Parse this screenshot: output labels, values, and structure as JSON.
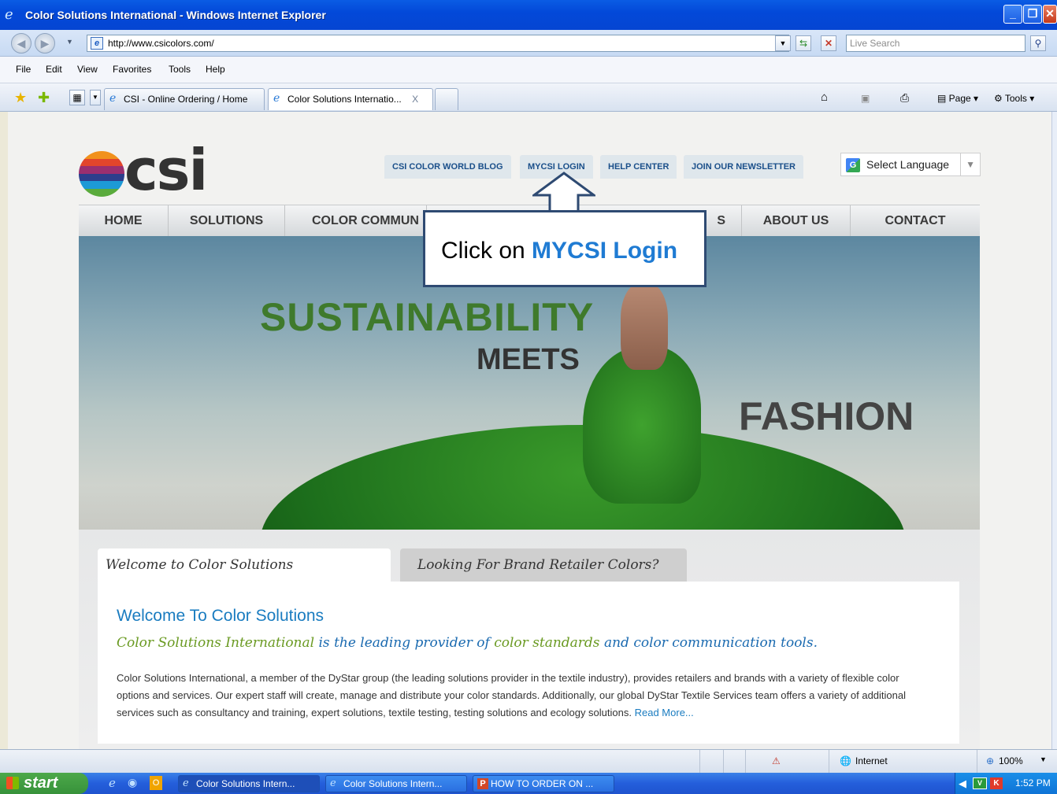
{
  "window": {
    "title": "Color Solutions International - Windows Internet Explorer"
  },
  "address": {
    "url": "http://www.csicolors.com/",
    "search_placeholder": "Live Search"
  },
  "menu": [
    "File",
    "Edit",
    "View",
    "Favorites",
    "Tools",
    "Help"
  ],
  "tabs": [
    {
      "label": "CSI - Online Ordering / Home"
    },
    {
      "label": "Color Solutions Internatio...",
      "close": "X"
    }
  ],
  "command_bar": {
    "page": "Page",
    "tools": "Tools"
  },
  "site": {
    "logo_text": "csi",
    "top_links": [
      "CSI COLOR WORLD BLOG",
      "MYCSI LOGIN",
      "HELP CENTER",
      "JOIN OUR NEWSLETTER"
    ],
    "language": "Select Language",
    "nav": [
      "HOME",
      "SOLUTIONS",
      "COLOR COMMUN",
      "S",
      "ABOUT US",
      "CONTACT"
    ],
    "hero": {
      "line1": "SUSTAINABILITY",
      "line2": "MEETS",
      "line3": "FASHION"
    },
    "content_tabs": [
      "Welcome to Color Solutions International",
      "Looking For Brand Retailer Colors?"
    ],
    "welcome_heading": "Welcome To Color Solutions",
    "subheading_green": "Color Solutions International",
    "subheading_rest1": " is the leading provider of ",
    "subheading_green2": "color standards",
    "subheading_rest2": " and color communication tools.",
    "paragraph": "Color Solutions International, a member of the DyStar group (the leading solutions provider in the textile industry), provides retailers and brands with a variety of flexible color options and services. Our expert staff will create, manage and distribute your color standards. Additionally, our global DyStar Textile Services team offers a variety of additional services such as consultancy and training, expert solutions, textile testing, testing solutions and ecology solutions.",
    "read_more": "Read More..."
  },
  "callout": {
    "prefix": "Click on ",
    "highlight": "MYCSI Login"
  },
  "status": {
    "zone": "Internet",
    "zoom": "100%"
  },
  "taskbar": {
    "start": "start",
    "buttons": [
      "Color Solutions Intern...",
      "Color Solutions Intern...",
      "HOW TO ORDER ON ..."
    ],
    "time": "1:52 PM"
  }
}
